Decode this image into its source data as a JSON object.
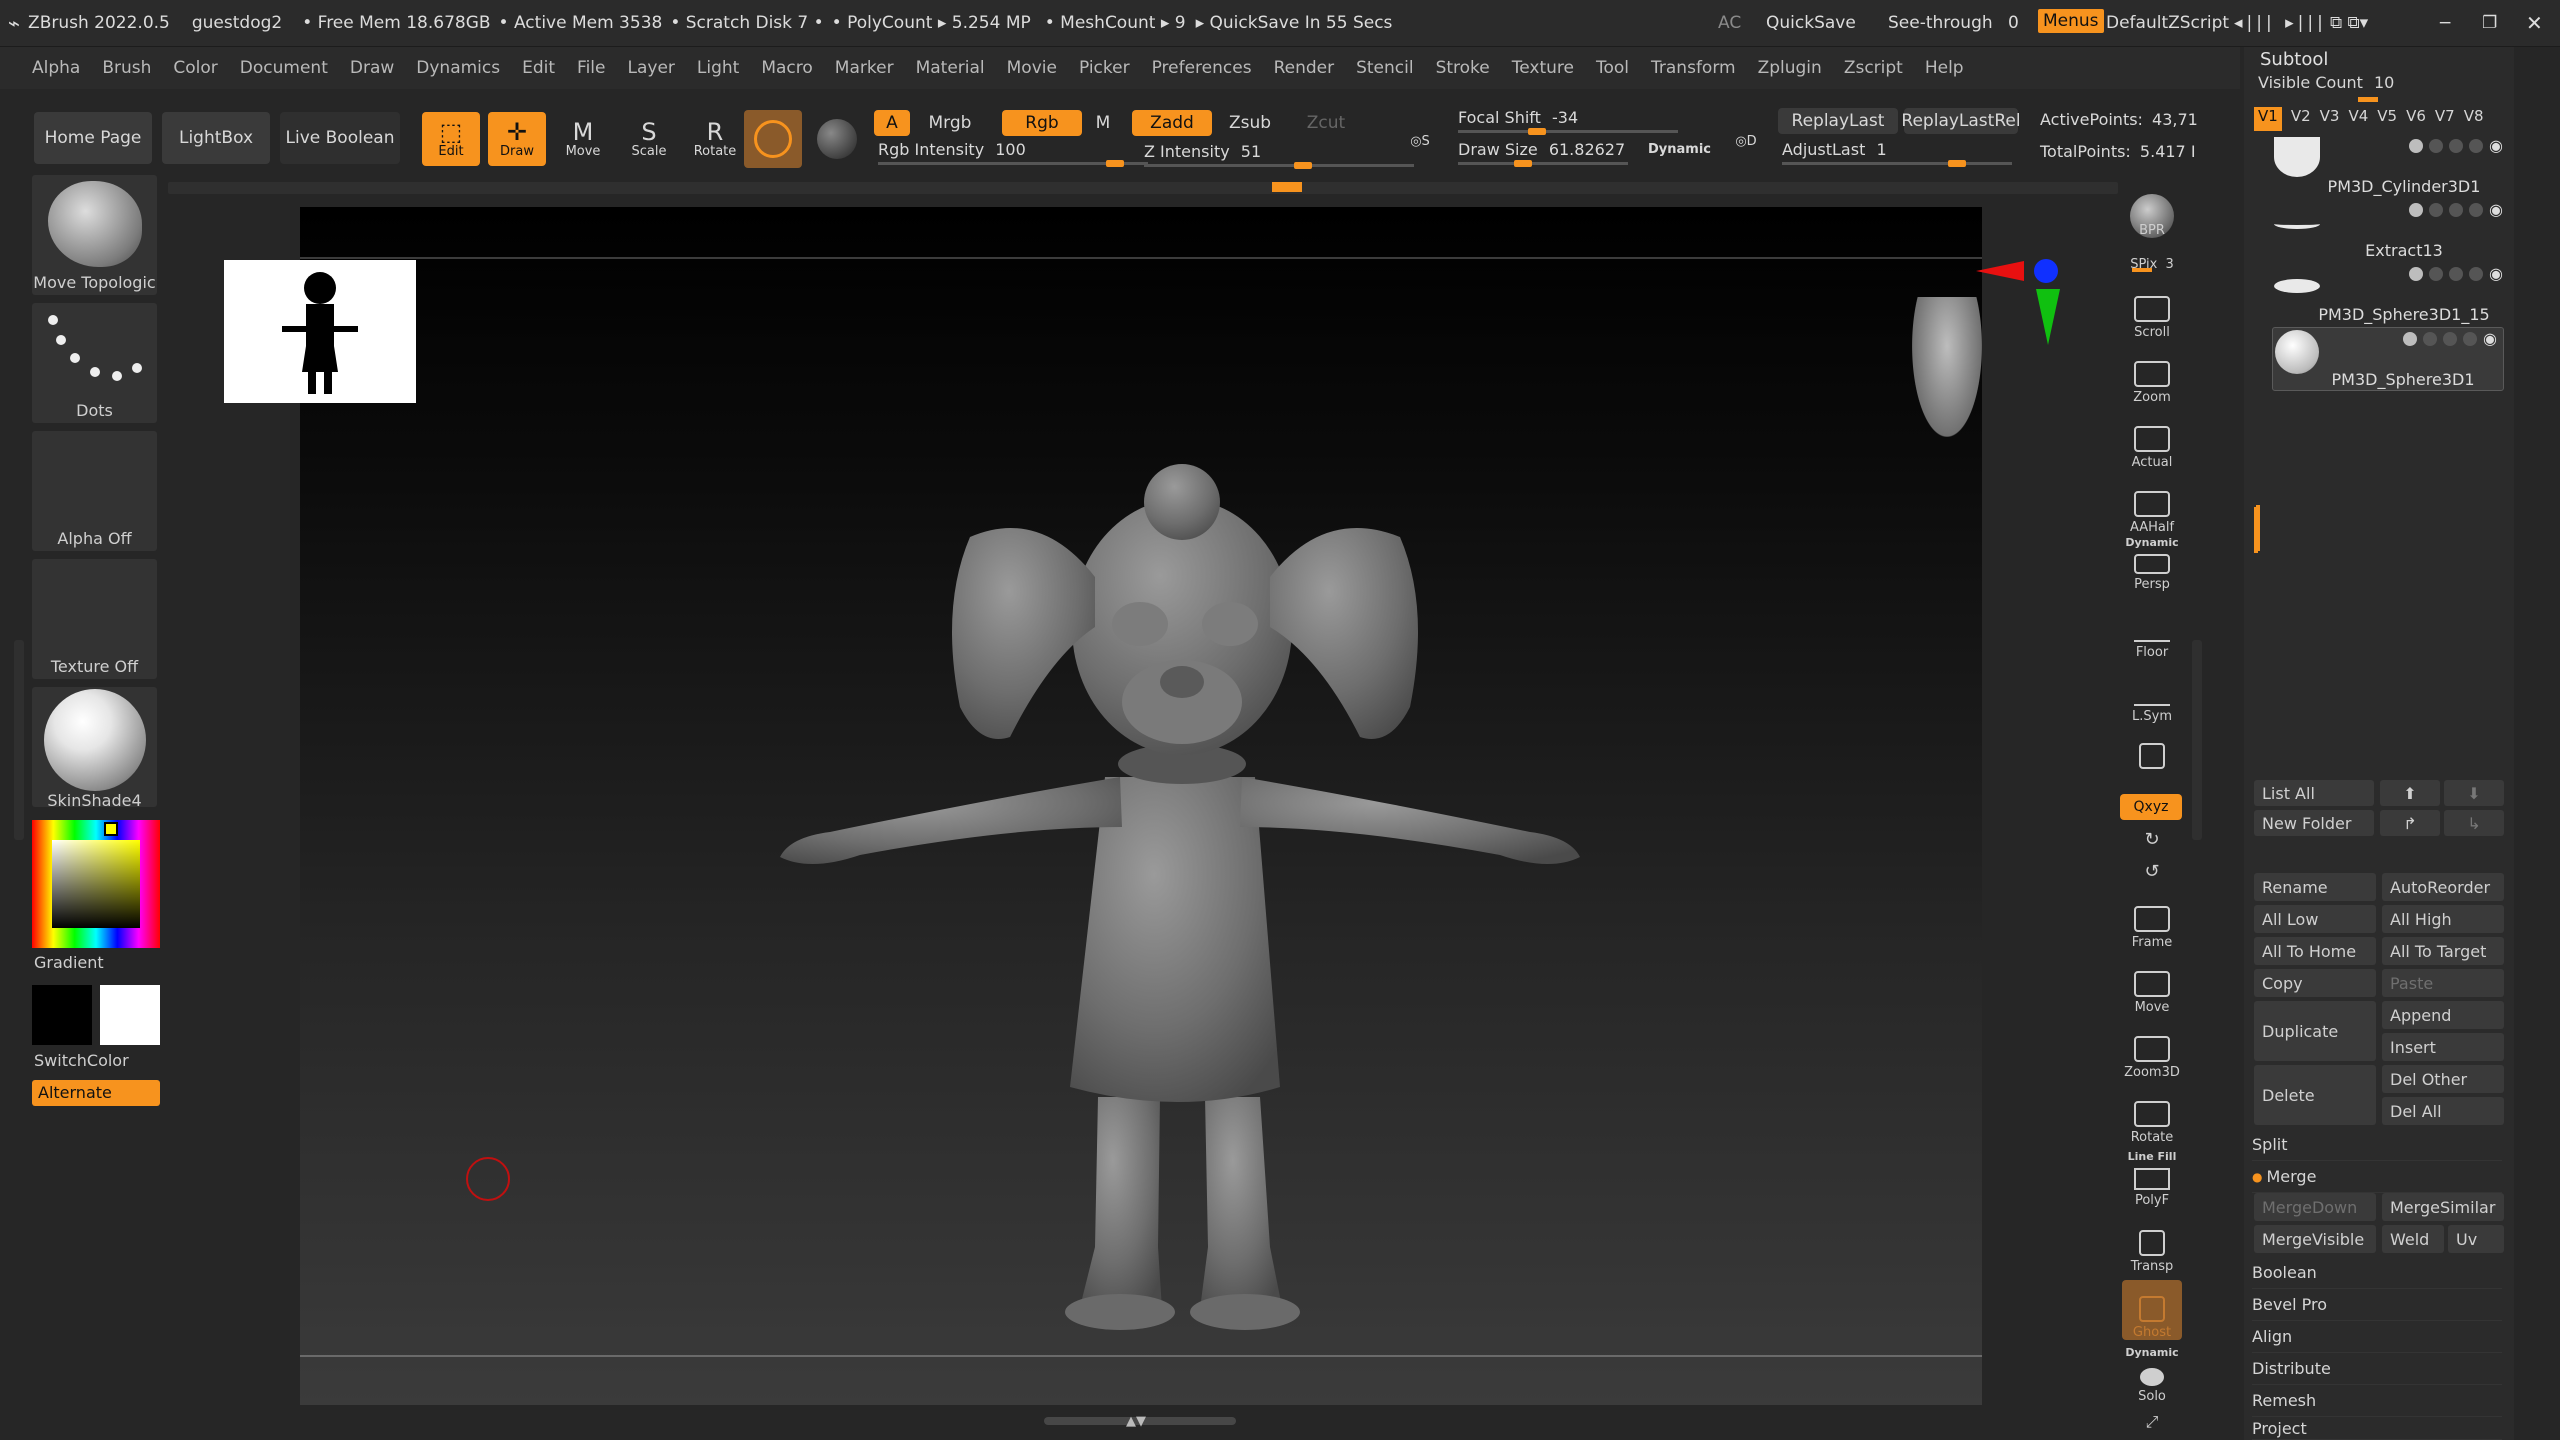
{
  "title_bar": {
    "app": "ZBrush 2022.0.5",
    "user": "guestdog2",
    "free_mem": "• Free Mem 18.678GB",
    "active_mem": "• Active Mem 3538",
    "scratch": "• Scratch Disk 7 •",
    "polycount": "• PolyCount ▸ 5.254 MP",
    "meshcount": "• MeshCount ▸ 9",
    "quicksave": "▸ QuickSave In 55 Secs",
    "ac": "AC",
    "quicksave_btn": "QuickSave",
    "see_through": "See-through",
    "see_through_value": "0",
    "menus": "Menus",
    "zscript": "DefaultZScript"
  },
  "menu": [
    "Alpha",
    "Brush",
    "Color",
    "Document",
    "Draw",
    "Dynamics",
    "Edit",
    "File",
    "Layer",
    "Light",
    "Macro",
    "Marker",
    "Material",
    "Movie",
    "Picker",
    "Preferences",
    "Render",
    "Stencil",
    "Stroke",
    "Texture",
    "Tool",
    "Transform",
    "Zplugin",
    "Zscript",
    "Help"
  ],
  "shelf": {
    "home": "Home Page",
    "lightbox": "LightBox",
    "live_boolean": "Live Boolean",
    "edit": "Edit",
    "draw": "Draw",
    "move": "Move",
    "scale": "Scale",
    "rotate": "Rotate",
    "a": "A",
    "mrgb": "Mrgb",
    "rgb": "Rgb",
    "m": "M",
    "zadd": "Zadd",
    "zsub": "Zsub",
    "zcut": "Zcut",
    "rgb_intensity_label": "Rgb Intensity",
    "rgb_intensity": "100",
    "z_intensity_label": "Z Intensity",
    "z_intensity": "51",
    "focal_shift_label": "Focal Shift",
    "focal_shift": "-34",
    "draw_size_label": "Draw Size",
    "draw_size": "61.82627",
    "dynamic": "Dynamic",
    "replay_last": "ReplayLast",
    "replay_last_rel": "ReplayLastRel",
    "adjust_last_label": "AdjustLast",
    "adjust_last": "1",
    "active_points_label": "ActivePoints:",
    "active_points": "43,71",
    "total_points_label": "TotalPoints:",
    "total_points": "5.417 I"
  },
  "left": {
    "brush": "Move Topologic",
    "stroke": "Dots",
    "alpha": "Alpha Off",
    "texture": "Texture Off",
    "material": "SkinShade4",
    "gradient": "Gradient",
    "switch": "SwitchColor",
    "alternate": "Alternate"
  },
  "right_strip": [
    "BPR",
    "SPix",
    "Scroll",
    "Zoom",
    "Actual",
    "AAHalf",
    "Persp",
    "Floor",
    "L.Sym",
    "Frame",
    "Move",
    "Zoom3D",
    "Rotate",
    "PolyF",
    "Transp",
    "Ghost",
    "Solo"
  ],
  "spix_value": "3",
  "strip_extra": {
    "dynamic": "Dynamic",
    "xyz": "Qxyz",
    "line_fill": "Line Fill"
  },
  "subtool": {
    "header": "Subtool",
    "visible_count_label": "Visible Count",
    "visible_count": "10",
    "versions": [
      "V1",
      "V2",
      "V3",
      "V4",
      "V5",
      "V6",
      "V7",
      "V8"
    ],
    "items": [
      "PM3D_Cylinder3D1",
      "Extract13",
      "PM3D_Sphere3D1_15",
      "PM3D_Sphere3D1"
    ],
    "list_all": "List All",
    "new_folder": "New Folder",
    "rename": "Rename",
    "autoreorder": "AutoReorder",
    "all_low": "All Low",
    "all_high": "All High",
    "all_to_home": "All To Home",
    "all_to_target": "All To Target",
    "copy": "Copy",
    "paste": "Paste",
    "duplicate": "Duplicate",
    "append": "Append",
    "insert": "Insert",
    "delete": "Delete",
    "del_other": "Del Other",
    "del_all": "Del All",
    "split": "Split",
    "merge": "Merge",
    "merge_down": "MergeDown",
    "merge_similar": "MergeSimilar",
    "merge_visible": "MergeVisible",
    "weld": "Weld",
    "uv": "Uv",
    "sections": [
      "Boolean",
      "Bevel Pro",
      "Align",
      "Distribute",
      "Remesh",
      "Project"
    ]
  },
  "colors": {
    "accent": "#f7931e",
    "bg": "#262626",
    "panel": "#2b2b2b",
    "button": "#3a3a3a"
  }
}
